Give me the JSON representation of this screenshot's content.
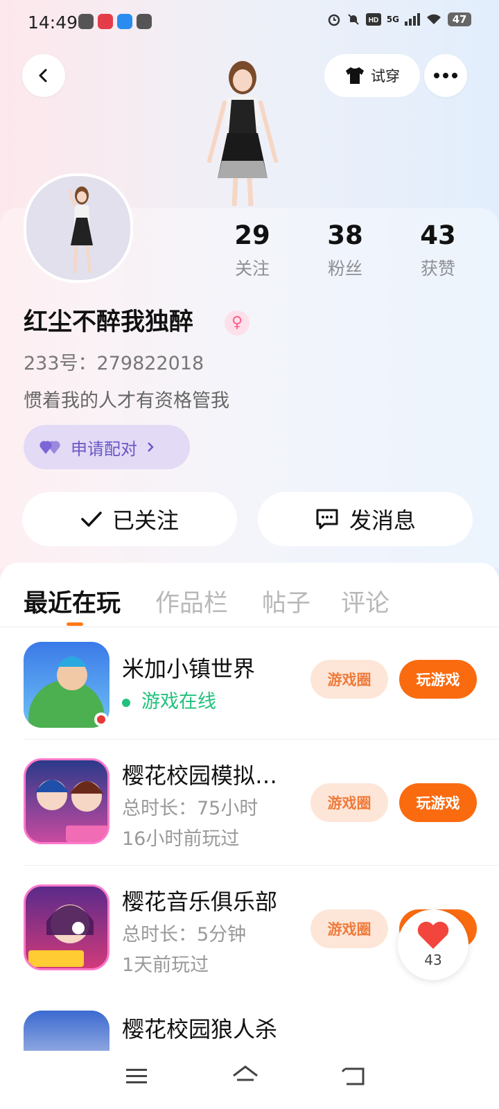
{
  "status_bar": {
    "time": "14:49",
    "network": "5G",
    "battery": "47",
    "icons": [
      "app-notif-icon",
      "app-notif-icon",
      "app-notif-icon",
      "app-notif-icon",
      "alarm-icon",
      "mute-icon",
      "hd-icon",
      "signal-icon",
      "wifi-icon"
    ]
  },
  "header": {
    "back_icon": "back-chevron-icon",
    "tryon_label": "试穿",
    "more_icon": "more-dots-icon"
  },
  "profile": {
    "name": "红尘不醉我独醉",
    "gender": "female",
    "uid": "233号：279822018",
    "bio": "惯着我的人才有资格管我",
    "match_label": "申请配对",
    "stats": [
      {
        "num": "29",
        "label": "关注"
      },
      {
        "num": "38",
        "label": "粉丝"
      },
      {
        "num": "43",
        "label": "获赞"
      }
    ],
    "follow_label": "已关注",
    "message_label": "发消息"
  },
  "tabs": [
    "最近在玩",
    "作品栏",
    "帖子",
    "评论"
  ],
  "active_tab": 0,
  "games": [
    {
      "title": "米加小镇世界",
      "line2": "游戏在线",
      "line3": "",
      "online": true,
      "circle_label": "游戏圈",
      "play_label": "玩游戏"
    },
    {
      "title": "樱花校园模拟…",
      "line2": "总时长：75小时",
      "line3": "16小时前玩过",
      "online": false,
      "circle_label": "游戏圈",
      "play_label": "玩游戏"
    },
    {
      "title": "樱花音乐俱乐部",
      "line2": "总时长：5分钟",
      "line3": "1天前玩过",
      "online": false,
      "circle_label": "游戏圈",
      "play_label": "玩游戏"
    },
    {
      "title": "樱花校园狼人杀"
    }
  ],
  "likes_float": {
    "count": "43"
  },
  "colors": {
    "accent": "#fa6b10",
    "online": "#22c07c",
    "match": "#6a58c4"
  }
}
